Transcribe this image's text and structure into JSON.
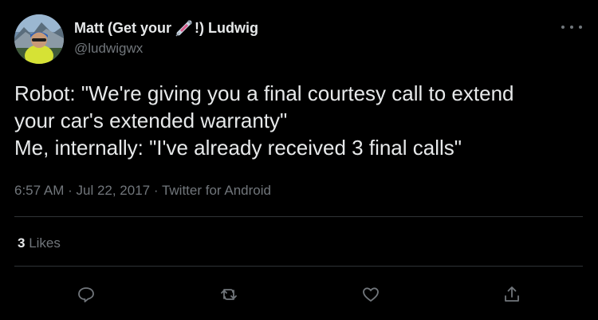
{
  "tweet": {
    "author_name": "Matt (Get your",
    "author_name_suffix": "!) Ludwig",
    "emoji": "syringe",
    "handle": "@ludwigwx",
    "text_lines": [
      "Robot: \"We're giving you a final courtesy call to extend",
      "your car's extended warranty\"",
      "Me, internally: \"I've already received 3 final calls\""
    ],
    "time": "6:57 AM",
    "date": "Jul 22, 2017",
    "source": "Twitter for Android",
    "likes_count": "3",
    "likes_label": "Likes"
  },
  "icons": {
    "more": "more-icon",
    "reply": "reply-icon",
    "retweet": "retweet-icon",
    "like": "heart-icon",
    "share": "share-icon"
  },
  "colors": {
    "background": "#000000",
    "text": "#e7e9ea",
    "secondary": "#71767b",
    "divider": "#2f3336"
  }
}
